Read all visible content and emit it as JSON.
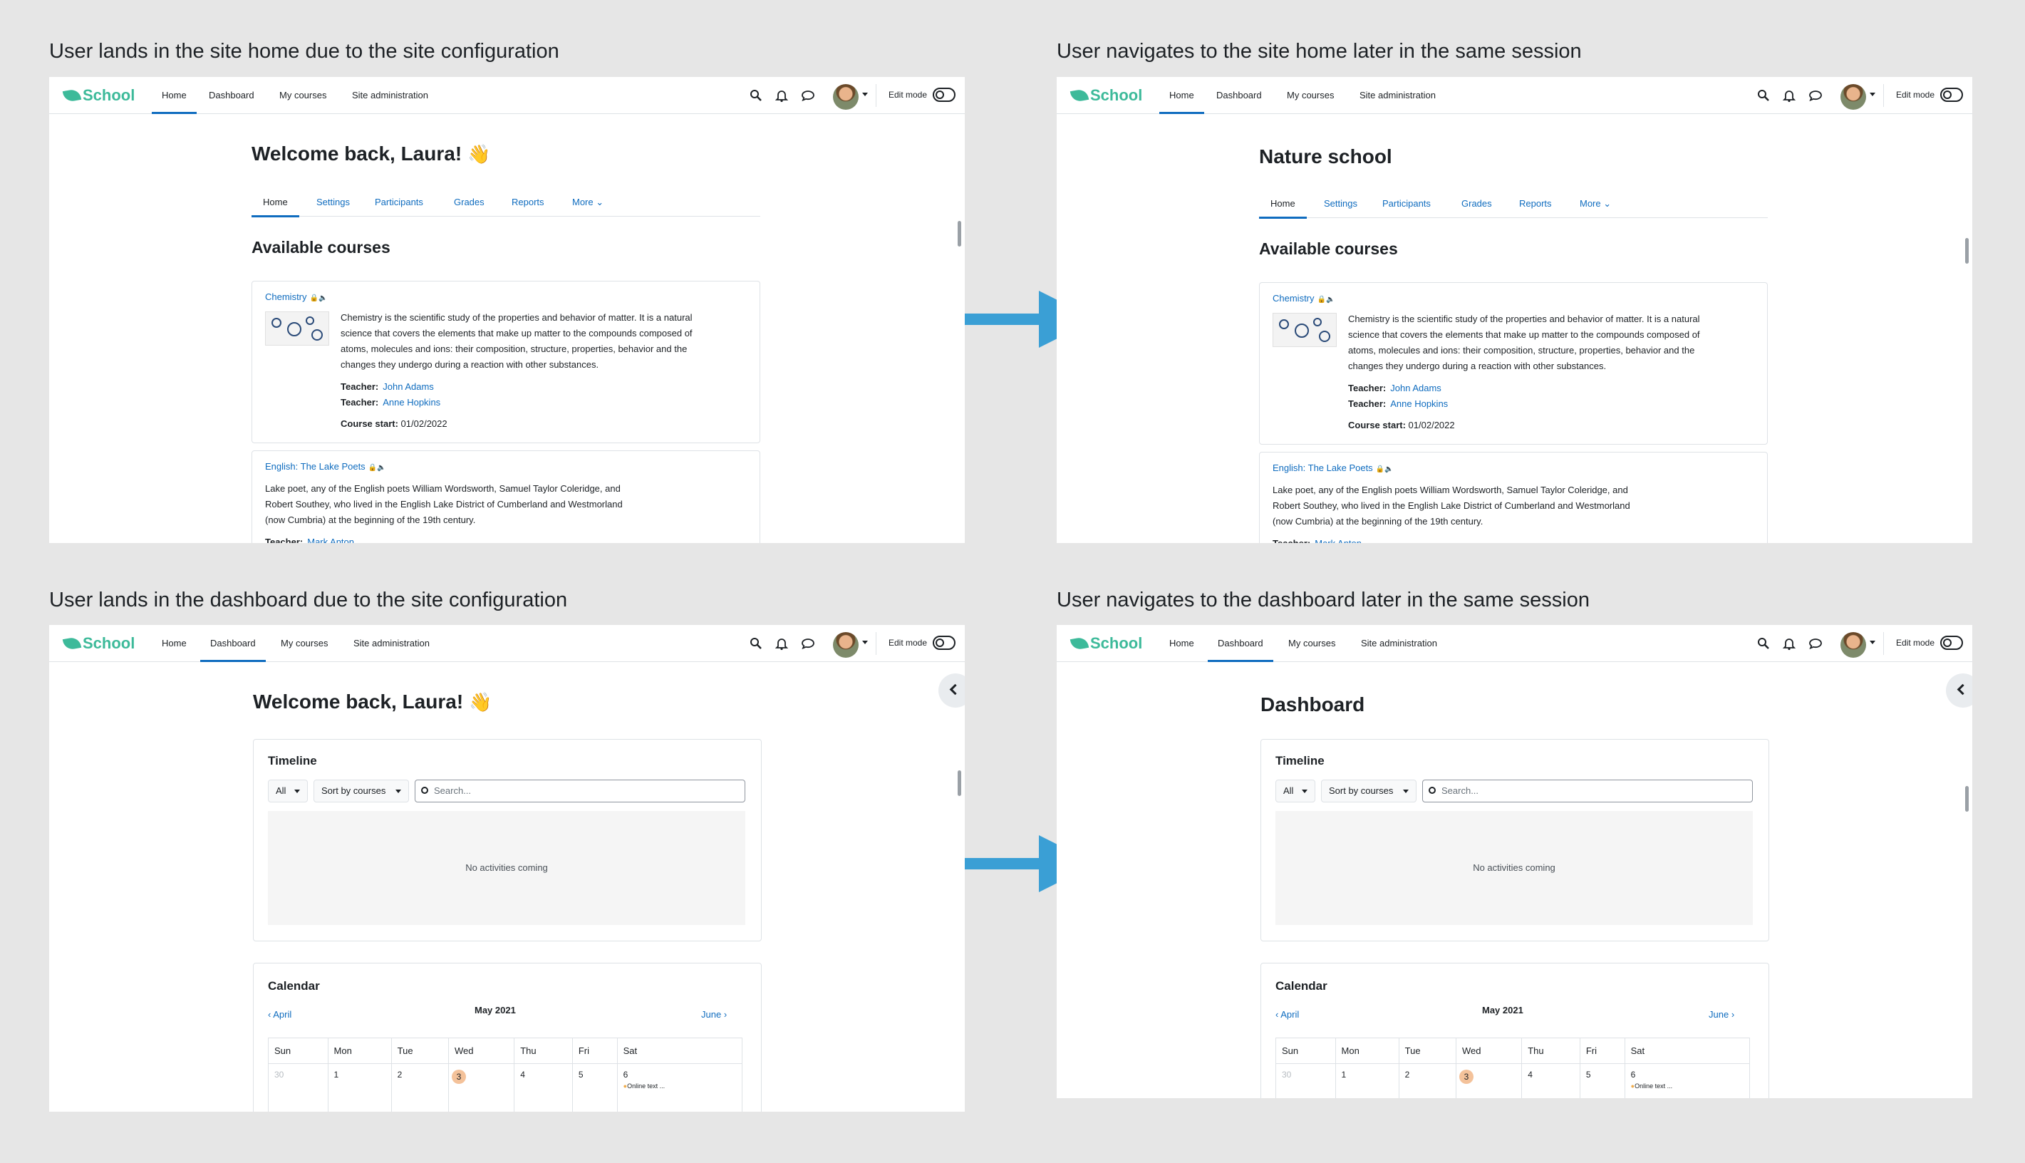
{
  "captions": {
    "top_left": "User lands in the site home due to the site configuration",
    "top_right": "User navigates to the site home later in the same session",
    "bottom_left": "User lands in the dashboard due to the site configuration",
    "bottom_right": "User navigates to the dashboard later in the same session"
  },
  "navbar": {
    "logo": "School",
    "items": [
      "Home",
      "Dashboard",
      "My courses",
      "Site administration"
    ],
    "edit_mode": "Edit mode",
    "icons": [
      "search-icon",
      "bell-icon",
      "message-icon",
      "avatar",
      "chevron-down-icon"
    ]
  },
  "site_home": {
    "welcome": "Welcome back, Laura!",
    "wave": "👋",
    "site_name": "Nature school",
    "secondary_nav": [
      "Home",
      "Settings",
      "Participants",
      "Grades",
      "Reports",
      "More"
    ],
    "available_heading": "Available courses",
    "courses": [
      {
        "name": "Chemistry",
        "icons": "🔒🔈",
        "summary": "Chemistry is the scientific study of the properties and behavior of matter. It is a natural science that covers the elements that make up matter to the compounds composed of atoms, molecules and ions: their composition, structure, properties, behavior and the changes they undergo during a reaction with other substances.",
        "teacher_label": "Teacher:",
        "teachers": [
          "John Adams",
          "Anne Hopkins"
        ],
        "start_label": "Course start:",
        "start": "01/02/2022"
      },
      {
        "name": "English: The Lake Poets",
        "icons": "🔒🔈",
        "summary": "Lake poet, any of the English poets William Wordsworth, Samuel Taylor Coleridge, and Robert Southey, who lived in the English Lake District of Cumberland and Westmorland (now Cumbria) at the beginning of the 19th century.",
        "teacher_label": "Teacher:",
        "teachers": [
          "Mark Anton"
        ]
      }
    ]
  },
  "dashboard": {
    "welcome": "Welcome back, Laura!",
    "wave": "👋",
    "title": "Dashboard",
    "timeline": {
      "title": "Timeline",
      "filter": "All",
      "sort": "Sort by courses",
      "search_placeholder": "Search...",
      "empty": "No activities coming"
    },
    "calendar": {
      "title": "Calendar",
      "prev": "April",
      "month": "May 2021",
      "next": "June",
      "days": [
        "Sun",
        "Mon",
        "Tue",
        "Wed",
        "Thu",
        "Fri",
        "Sat"
      ],
      "dates": [
        "30",
        "1",
        "2",
        "3",
        "4",
        "5",
        "6"
      ],
      "today": "3",
      "event": "Online text ..."
    }
  }
}
